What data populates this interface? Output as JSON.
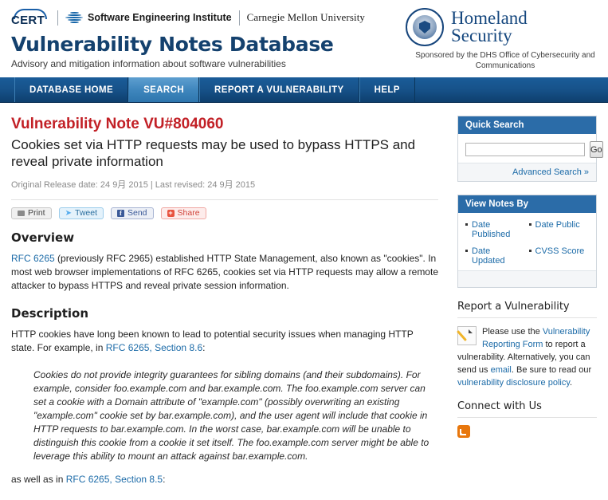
{
  "header": {
    "cert_label": "CERT",
    "sei_name": "Software Engineering Institute",
    "cmu_name": "Carnegie Mellon University",
    "site_title": "Vulnerability Notes Database",
    "tagline": "Advisory and mitigation information about software vulnerabilities",
    "dhs_line1": "Homeland",
    "dhs_line2": "Security",
    "dhs_sponsor": "Sponsored by the DHS Office of Cybersecurity and Communications"
  },
  "nav": {
    "items": [
      {
        "label": "DATABASE HOME",
        "active": false
      },
      {
        "label": "SEARCH",
        "active": true
      },
      {
        "label": "REPORT A VULNERABILITY",
        "active": false
      },
      {
        "label": "HELP",
        "active": false
      }
    ]
  },
  "note": {
    "vu_id": "Vulnerability Note VU#804060",
    "title": "Cookies set via HTTP requests may be used to bypass HTTPS and reveal private information",
    "dates": "Original Release date: 24 9月 2015 | Last revised: 24 9月 2015",
    "share": {
      "print": "Print",
      "tweet": "Tweet",
      "send": "Send",
      "share": "Share"
    },
    "overview": {
      "heading": "Overview",
      "link_text": "RFC 6265",
      "body": " (previously RFC 2965) established HTTP State Management, also known as \"cookies\". In most web browser implementations of RFC 6265, cookies set via HTTP requests may allow a remote attacker to bypass HTTPS and reveal private session information."
    },
    "description": {
      "heading": "Description",
      "intro": "HTTP cookies have long been known to lead to potential security issues when managing HTTP state. For example, in ",
      "link_text": "RFC 6265, Section 8.6",
      "intro_tail": ":",
      "quote": "Cookies do not provide integrity guarantees for sibling domains (and their subdomains). For example, consider foo.example.com and bar.example.com. The foo.example.com server can set a cookie with a Domain attribute of \"example.com\" (possibly overwriting an existing \"example.com\" cookie set by bar.example.com), and the user agent will include that cookie in HTTP requests to bar.example.com. In the worst case, bar.example.com will be unable to distinguish this cookie from a cookie it set itself. The foo.example.com server might be able to leverage this ability to mount an attack against bar.example.com.",
      "tail_intro": "as well as in ",
      "tail_link": "RFC 6265, Section 8.5",
      "tail_end": ":"
    }
  },
  "sidebar": {
    "quick_search": {
      "heading": "Quick Search",
      "input_value": "",
      "input_placeholder": "",
      "go_label": "Go",
      "advanced_label": "Advanced Search »"
    },
    "view_notes_by": {
      "heading": "View Notes By",
      "links": [
        "Date Published",
        "Date Public",
        "Date Updated",
        "CVSS Score"
      ]
    },
    "report": {
      "heading": "Report a Vulnerability",
      "text_1": "Please use the ",
      "link_1": "Vulnerability Reporting Form",
      "text_2": " to report a vulnerability. Alternatively, you can send us ",
      "link_2": "email",
      "text_3": ". Be sure to read our ",
      "link_3": "vulnerability disclosure policy",
      "text_4": "."
    },
    "connect": {
      "heading": "Connect with Us"
    }
  },
  "colors": {
    "brand_blue": "#14416e",
    "nav_blue": "#17538b",
    "accent_red": "#c22026",
    "link_blue": "#1c6ba8",
    "panel_head": "#2b6ca8",
    "rss_orange": "#e8770d"
  }
}
